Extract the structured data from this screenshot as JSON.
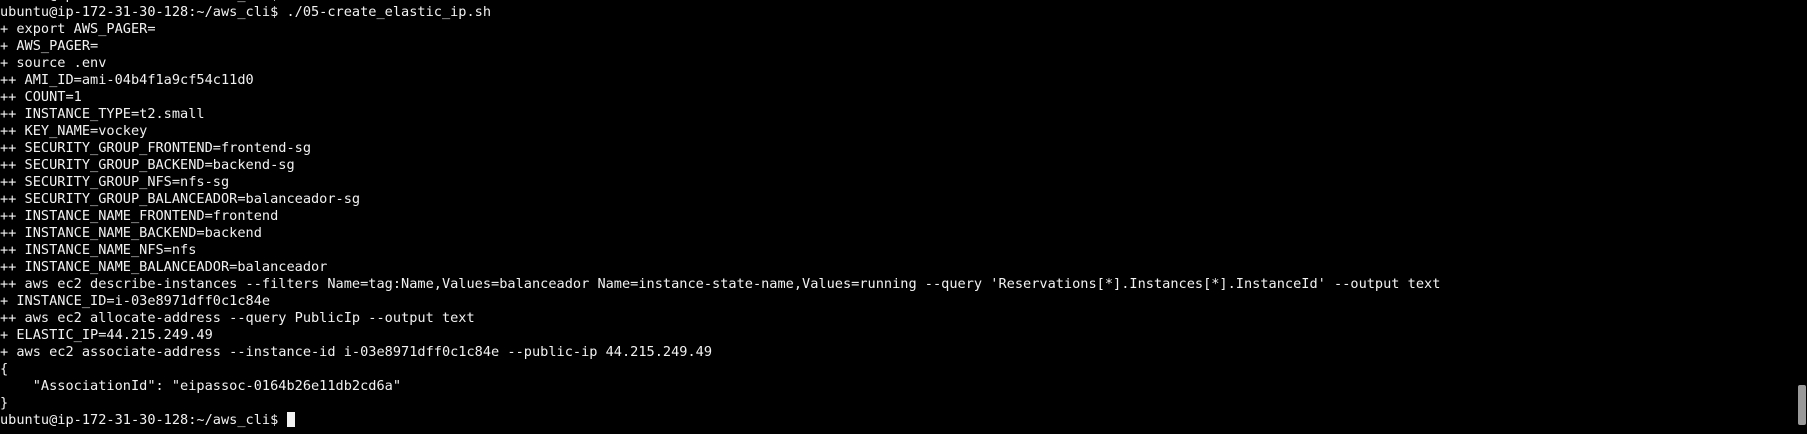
{
  "terminal": {
    "prompt": "ubuntu@ip-172-31-30-128:~/aws_cli$",
    "lines": [
      "ubuntu@ip-172-31-30-128:~/aws_cli$ ./05-create_elastic_ip.sh",
      "+ export AWS_PAGER=",
      "+ AWS_PAGER=",
      "+ source .env",
      "++ AMI_ID=ami-04b4f1a9cf54c11d0",
      "++ COUNT=1",
      "++ INSTANCE_TYPE=t2.small",
      "++ KEY_NAME=vockey",
      "++ SECURITY_GROUP_FRONTEND=frontend-sg",
      "++ SECURITY_GROUP_BACKEND=backend-sg",
      "++ SECURITY_GROUP_NFS=nfs-sg",
      "++ SECURITY_GROUP_BALANCEADOR=balanceador-sg",
      "++ INSTANCE_NAME_FRONTEND=frontend",
      "++ INSTANCE_NAME_BACKEND=backend",
      "++ INSTANCE_NAME_NFS=nfs",
      "++ INSTANCE_NAME_BALANCEADOR=balanceador",
      "++ aws ec2 describe-instances --filters Name=tag:Name,Values=balanceador Name=instance-state-name,Values=running --query 'Reservations[*].Instances[*].InstanceId' --output text",
      "+ INSTANCE_ID=i-03e8971dff0c1c84e",
      "++ aws ec2 allocate-address --query PublicIp --output text",
      "+ ELASTIC_IP=44.215.249.49",
      "+ aws ec2 associate-address --instance-id i-03e8971dff0c1c84e --public-ip 44.215.249.49",
      "{",
      "    \"AssociationId\": \"eipassoc-0164b26e11db2cd6a\"",
      "}"
    ]
  }
}
